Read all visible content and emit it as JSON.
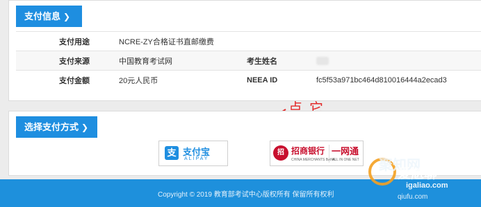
{
  "info_section": {
    "title": "支付信息",
    "rows": [
      {
        "label": "支付用途",
        "value": "NCRE-ZY合格证书直邮缴费",
        "label2": "",
        "value2": ""
      },
      {
        "label": "支付来源",
        "value": "中国教育考试网",
        "label2": "考生姓名",
        "value2": ""
      },
      {
        "label": "支付金额",
        "value": "20元人民币",
        "label2": "NEEA ID",
        "value2": "fc5f53a971bc464d810016444a2ecad3"
      }
    ]
  },
  "pay_section": {
    "title": "选择支付方式",
    "annotation": "点它",
    "methods": {
      "alipay": {
        "name": "支付宝",
        "sub": "ALIPAY",
        "icon": "支"
      },
      "cmb": {
        "name": "招商银行",
        "sub": "CHINA MERCHANTS BANK",
        "wang": "一网通",
        "wang_sub": "ALL IN ONE NET",
        "icon": "招"
      }
    }
  },
  "footer": {
    "copyright": "Copyright © 2019 教育部考试中心版权所有 保留所有权利"
  },
  "watermark": {
    "line1": "聚知网",
    "line2": "爱尬聊",
    "line3": "igaliao.com",
    "line4": "qiufu.com"
  },
  "colors": {
    "accent": "#1e8ee0",
    "annotation": "#e32a2a",
    "bank": "#c8102e"
  }
}
